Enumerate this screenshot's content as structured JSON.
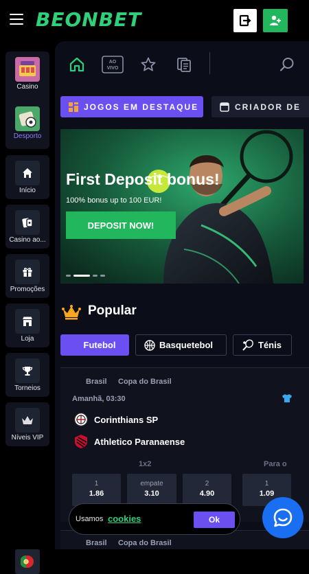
{
  "header": {
    "logo": "BEONBET",
    "menu_icon": "hamburger-icon",
    "login_icon": "login-icon",
    "register_icon": "add-user-icon",
    "brand_green": "#22b65d",
    "accent_purple": "#6c4ff0"
  },
  "sidebar": {
    "items": [
      {
        "label": "Casino",
        "icon": "casino-icon"
      },
      {
        "label": "Desporto",
        "icon": "sports-icon"
      },
      {
        "label": "Início",
        "icon": "home-icon"
      },
      {
        "label": "Casino ao...",
        "icon": "live-casino-icon"
      },
      {
        "label": "Promoções",
        "icon": "gift-icon"
      },
      {
        "label": "Loja",
        "icon": "shop-icon"
      },
      {
        "label": "Torneios",
        "icon": "trophy-icon"
      },
      {
        "label": "Níveis VIP",
        "icon": "crown-icon"
      }
    ],
    "language_icon": "portugal-flag-icon"
  },
  "nav": {
    "live_label_1": "AO",
    "live_label_2": "VIVO"
  },
  "pills": {
    "featured": "JOGOS EM DESTAQUE",
    "creator": "CRIADOR DE"
  },
  "banner": {
    "title": "First Deposit bonus!",
    "subtitle": "100% bonus up to 100 EUR!",
    "button": "DEPOSIT NOW!",
    "slides": 4,
    "active_slide": 2
  },
  "popular": {
    "title": "Popular",
    "tabs": [
      "Futebol",
      "Basquetebol",
      "Ténis"
    ]
  },
  "match": {
    "country": "Brasil",
    "competition": "Copa do Brasil",
    "time": "Amanhã, 03:30",
    "home": "Corinthians SP",
    "away": "Athletico Paranaense",
    "market1": "1x2",
    "market2": "Para o",
    "odds": [
      {
        "label": "1",
        "value": "1.86"
      },
      {
        "label": "empate",
        "value": "3.10"
      },
      {
        "label": "2",
        "value": "4.90"
      },
      {
        "label": "1",
        "value": "1.09"
      }
    ]
  },
  "match2": {
    "country": "Brasil",
    "competition": "Copa do Brasil"
  },
  "cookie": {
    "text": "Usamos",
    "link": "cookies",
    "ok": "Ok"
  }
}
